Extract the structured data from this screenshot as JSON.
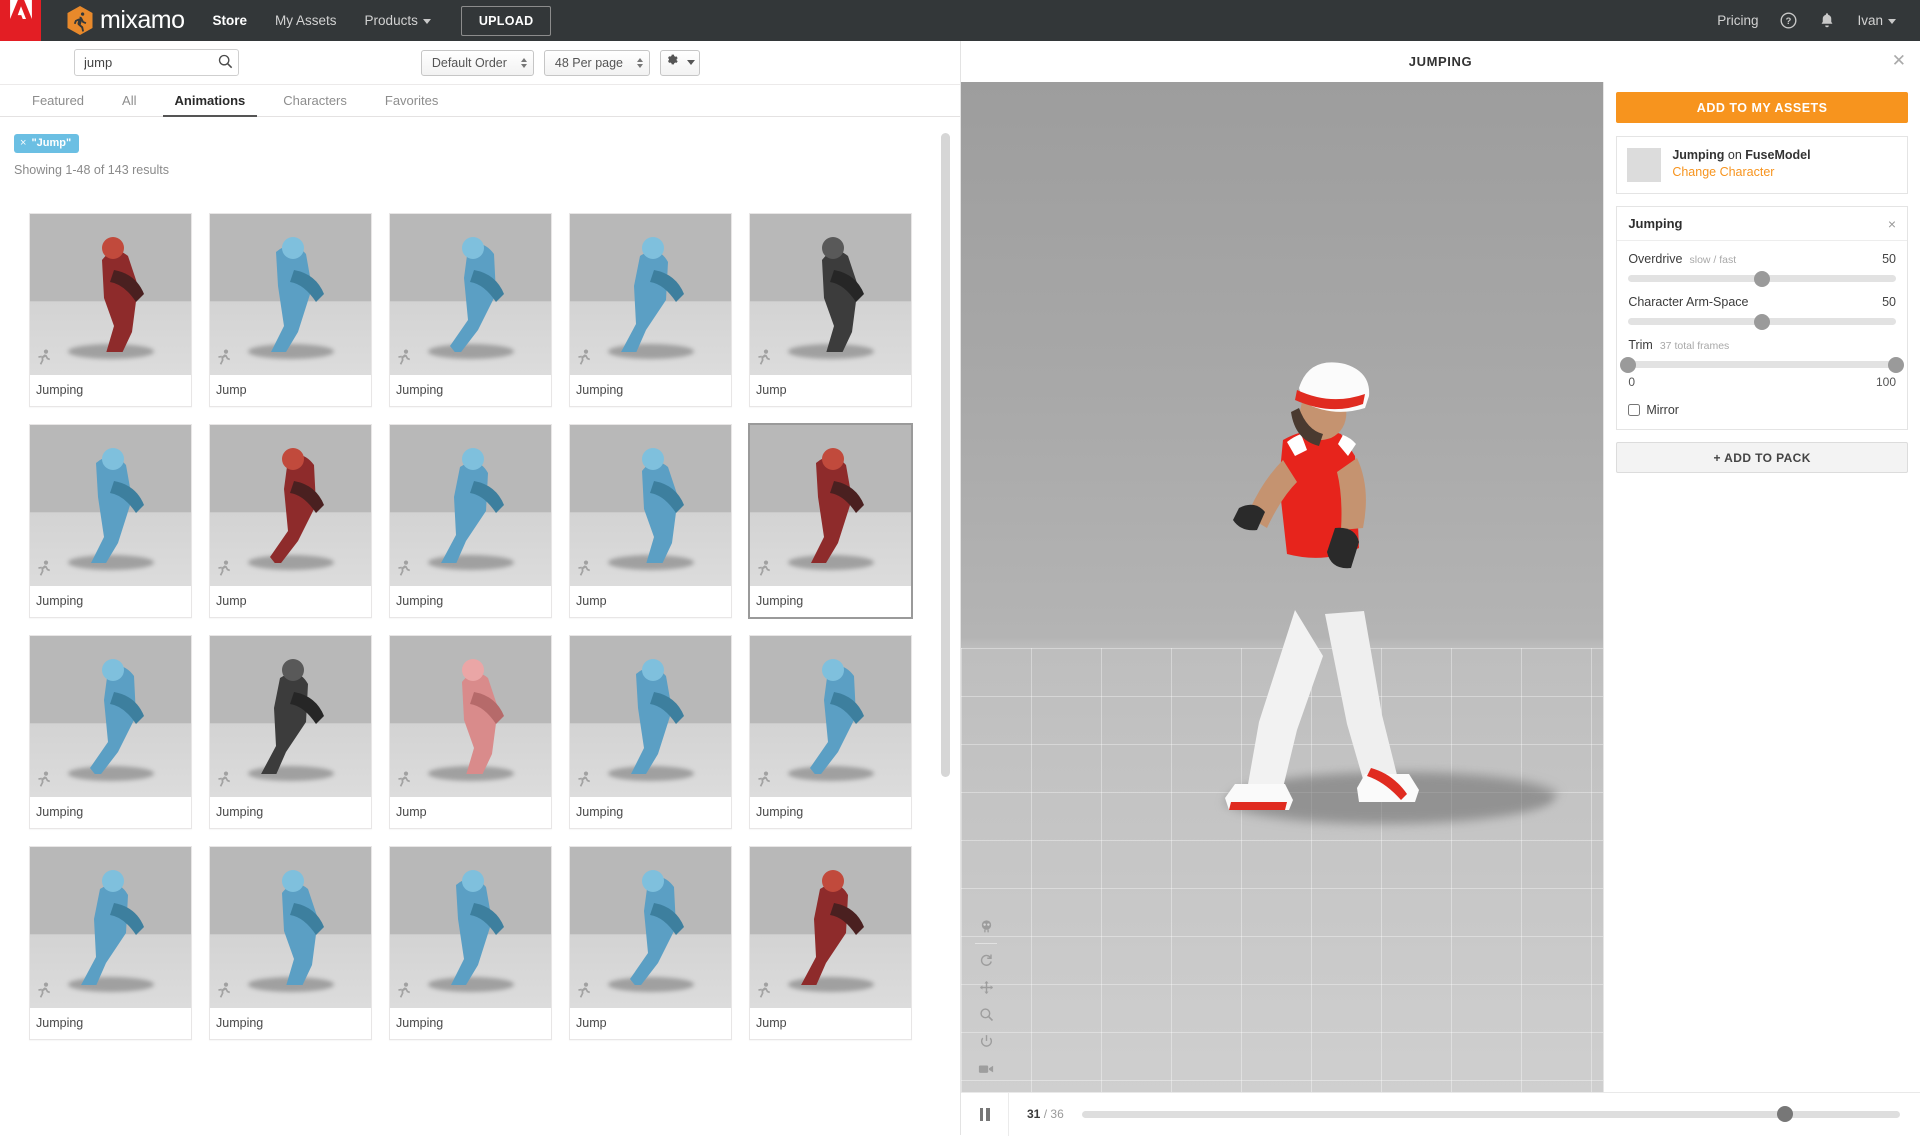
{
  "topnav": {
    "brand": "mixamo",
    "adobe_logo_label": "Adobe",
    "links": [
      {
        "label": "Store",
        "active": true
      },
      {
        "label": "My Assets",
        "active": false
      },
      {
        "label": "Products",
        "active": false,
        "caret": true
      }
    ],
    "upload_label": "UPLOAD",
    "right": {
      "pricing": "Pricing",
      "help_icon": "help-circle-icon",
      "bell_icon": "bell-icon",
      "user": "Ivan"
    },
    "bg_color": "#333739",
    "adobe_red": "#e31e24",
    "mixamo_orange": "#e8892b"
  },
  "browse": {
    "search": {
      "value": "jump",
      "placeholder": "Search"
    },
    "sort": {
      "label": "Default Order"
    },
    "per_page": {
      "label": "48 Per page"
    },
    "gear_label": "settings-menu",
    "tabs": [
      {
        "label": "Featured",
        "active": false
      },
      {
        "label": "All",
        "active": false
      },
      {
        "label": "Animations",
        "active": true
      },
      {
        "label": "Characters",
        "active": false
      },
      {
        "label": "Favorites",
        "active": false
      }
    ],
    "chip": {
      "remove": "×",
      "label": "\"Jump\"",
      "color": "#6bbfe3"
    },
    "results_text": "Showing 1-48 of 143 results",
    "cards": [
      {
        "label": "Jumping",
        "selected": false,
        "tone": "red"
      },
      {
        "label": "Jump",
        "selected": false,
        "tone": "blue"
      },
      {
        "label": "Jumping",
        "selected": false,
        "tone": "blue"
      },
      {
        "label": "Jumping",
        "selected": false,
        "tone": "blue"
      },
      {
        "label": "Jump",
        "selected": false,
        "tone": "dark"
      },
      {
        "label": "Jumping",
        "selected": false,
        "tone": "blue"
      },
      {
        "label": "Jump",
        "selected": false,
        "tone": "red"
      },
      {
        "label": "Jumping",
        "selected": false,
        "tone": "blue"
      },
      {
        "label": "Jump",
        "selected": false,
        "tone": "blue"
      },
      {
        "label": "Jumping",
        "selected": true,
        "tone": "red"
      },
      {
        "label": "Jumping",
        "selected": false,
        "tone": "blue"
      },
      {
        "label": "Jumping",
        "selected": false,
        "tone": "dark"
      },
      {
        "label": "Jump",
        "selected": false,
        "tone": "pink"
      },
      {
        "label": "Jumping",
        "selected": false,
        "tone": "blue"
      },
      {
        "label": "Jumping",
        "selected": false,
        "tone": "blue"
      },
      {
        "label": "Jumping",
        "selected": false,
        "tone": "blue"
      },
      {
        "label": "Jumping",
        "selected": false,
        "tone": "blue"
      },
      {
        "label": "Jumping",
        "selected": false,
        "tone": "blue"
      },
      {
        "label": "Jump",
        "selected": false,
        "tone": "blue"
      },
      {
        "label": "Jump",
        "selected": false,
        "tone": "red"
      }
    ]
  },
  "viewer": {
    "title": "JUMPING",
    "close_icon": "close-icon",
    "timeline": {
      "play_state": "pause",
      "current_frame": "31",
      "separator": "/",
      "total_frames": "36",
      "progress_percent": 86
    },
    "stage_tools": [
      {
        "name": "skeleton-icon",
        "glyph": "skull"
      },
      {
        "name": "reset-rotation-icon",
        "glyph": "rotate"
      },
      {
        "name": "pan-icon",
        "glyph": "move"
      },
      {
        "name": "zoom-icon",
        "glyph": "magnifier"
      },
      {
        "name": "power-icon",
        "glyph": "power"
      },
      {
        "name": "video-camera-icon",
        "glyph": "camera"
      }
    ]
  },
  "settings": {
    "add_to_assets": "ADD TO MY ASSETS",
    "character": {
      "anim_name": "Jumping",
      "connector": " on ",
      "model_name": "FuseModel",
      "change_link": "Change Character"
    },
    "anim_panel_title": "Jumping",
    "anim_panel_close": "×",
    "controls": [
      {
        "name": "Overdrive",
        "hint": "slow / fast",
        "value": "50",
        "percent": 50
      },
      {
        "name": "Character Arm-Space",
        "hint": "",
        "value": "50",
        "percent": 50
      }
    ],
    "trim": {
      "name": "Trim",
      "hint": "37 total frames",
      "min_label": "0",
      "max_label": "100",
      "min_percent": 0,
      "max_percent": 100
    },
    "mirror_label": "Mirror",
    "mirror_checked": false,
    "add_to_pack": "+ ADD TO PACK",
    "accent_color": "#f7941e"
  }
}
